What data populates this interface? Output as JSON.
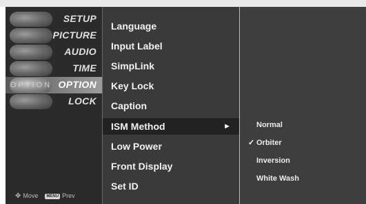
{
  "categories": [
    {
      "label": "SETUP",
      "icon": "satellite-dish-icon",
      "active": false
    },
    {
      "label": "PICTURE",
      "icon": "picture-icon",
      "active": false
    },
    {
      "label": "AUDIO",
      "icon": "speaker-icon",
      "active": false
    },
    {
      "label": "TIME",
      "icon": "clock-icon",
      "active": false
    },
    {
      "label": "OPTION",
      "icon": "option-icon",
      "active": true,
      "thumb_text": "OPTION"
    },
    {
      "label": "LOCK",
      "icon": "lock-icon",
      "active": false
    }
  ],
  "nav_hint": {
    "move_label": "Move",
    "move_icon": "dpad-icon",
    "menu_key_label": "MENU",
    "prev_label": "Prev"
  },
  "options": [
    {
      "label": "Language"
    },
    {
      "label": "Input Label"
    },
    {
      "label": "SimpLink"
    },
    {
      "label": "Key Lock"
    },
    {
      "label": "Caption"
    },
    {
      "label": "ISM Method",
      "active": true,
      "arrow": "►"
    },
    {
      "label": "Low Power"
    },
    {
      "label": "Front Display"
    },
    {
      "label": "Set ID"
    }
  ],
  "ism_submenu": [
    {
      "label": "Normal",
      "selected": false
    },
    {
      "label": "Orbiter",
      "selected": true,
      "check": "✓"
    },
    {
      "label": "Inversion",
      "selected": false
    },
    {
      "label": "White Wash",
      "selected": false
    }
  ],
  "colors": {
    "panel_bg": "#3a3a3a",
    "left_bg": "#2b2b2b",
    "highlight": "#222222",
    "text": "#f2f2f2"
  }
}
